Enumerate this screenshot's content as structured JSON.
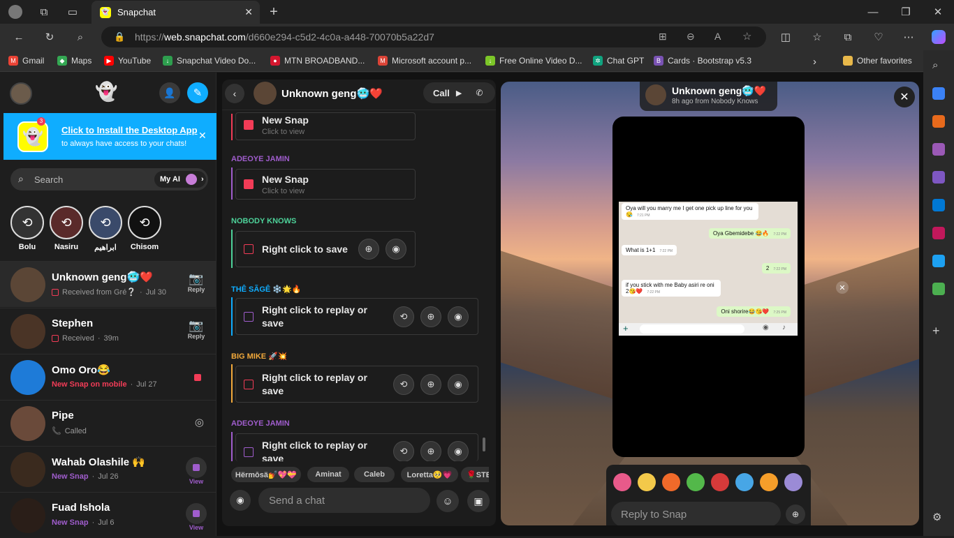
{
  "browser": {
    "tab_title": "Snapchat",
    "url_prefix": "https://",
    "url_host": "web.snapchat.com",
    "url_path": "/d660e294-c5d2-4c0a-a448-70070b5a22d7",
    "favorites": [
      "Gmail",
      "Maps",
      "YouTube",
      "Snapchat Video Do...",
      "MTN BROADBAND...",
      "Microsoft account p...",
      "Free Online Video D...",
      "Chat GPT",
      "Cards · Bootstrap v5.3"
    ],
    "other_favorites": "Other favorites"
  },
  "banner": {
    "title": "Click to Install the Desktop App",
    "subtitle": "to always have access to your chats!",
    "badge": "3"
  },
  "search": {
    "placeholder": "Search",
    "my_ai": "My AI"
  },
  "stories": [
    "Bolu",
    "Nasiru",
    "ابراهيم",
    "Chisom"
  ],
  "chats": [
    {
      "name": "Unknown geng🥶❤️",
      "status": "Received from Gré❔",
      "time": "Jul 30",
      "action": "Reply",
      "status_color": "#f23c57"
    },
    {
      "name": "Stephen",
      "status": "Received",
      "time": "39m",
      "action": "Reply",
      "status_color": "#f23c57"
    },
    {
      "name": "Omo Oro😂",
      "status": "New Snap on mobile",
      "time": "Jul 27",
      "action": "",
      "status_color": "#f23c57"
    },
    {
      "name": "Pipe",
      "status": "Called",
      "time": "",
      "action": "",
      "status_color": "#0fadff"
    },
    {
      "name": "Wahab Olashile 🙌",
      "status": "New Snap",
      "time": "Jul 26",
      "action": "View",
      "status_color": "#a05dcd"
    },
    {
      "name": "Fuad Ishola",
      "status": "New Snap",
      "time": "Jul 6",
      "action": "View",
      "status_color": "#a05dcd"
    }
  ],
  "conversation": {
    "title": "Unknown geng🥶❤️",
    "call_label": "Call",
    "messages": [
      {
        "sender": "",
        "line1": "New Snap",
        "line2": "Click to view"
      },
      {
        "sender": "ADEOYE JAMIN",
        "line1": "New Snap",
        "line2": "Click to view"
      },
      {
        "sender": "NOBODY KNOWS",
        "line1": "Right click to save",
        "line2": ""
      },
      {
        "sender": "THÊ SÃGÊ ❄️🌟🔥",
        "line1": "Right click to replay or",
        "line2": "save"
      },
      {
        "sender": "BIG MIKE 🚀💥",
        "line1": "Right click to replay or",
        "line2": "save"
      },
      {
        "sender": "ADEOYE JAMIN",
        "line1": "Right click to replay or",
        "line2": "save"
      }
    ],
    "chips": [
      "Hërmōsä💅💖💝",
      "Aminat",
      "Caleb",
      "Loretta🥺💗",
      "🌹STE"
    ],
    "input_placeholder": "Send a chat"
  },
  "viewer": {
    "title": "Unknown geng🥶❤️",
    "subtitle": "8h ago from Nobody Knows",
    "reply_placeholder": "Reply to Snap",
    "whatsapp": [
      {
        "side": "l",
        "text": "Oya will you marry me I get one pick up line for you 😪",
        "time": "7:21 PM"
      },
      {
        "side": "r",
        "text": "Oya Gbemidebe 😂🔥",
        "time": "7:22 PM"
      },
      {
        "side": "l",
        "text": "What is 1+1",
        "time": "7:22 PM"
      },
      {
        "side": "r",
        "text": "2",
        "time": "7:22 PM"
      },
      {
        "side": "l",
        "text": "if you stick with me Baby asiri re oni 2😘❤️",
        "time": "7:22 PM"
      },
      {
        "side": "r",
        "text": "Oni shorire😂😘❤️",
        "time": "7:25 PM"
      }
    ]
  },
  "colors": {
    "snap_red": "#f23c57",
    "snap_purple": "#a05dcd",
    "snap_blue": "#0fadff",
    "snap_yellow": "#fffc00"
  }
}
